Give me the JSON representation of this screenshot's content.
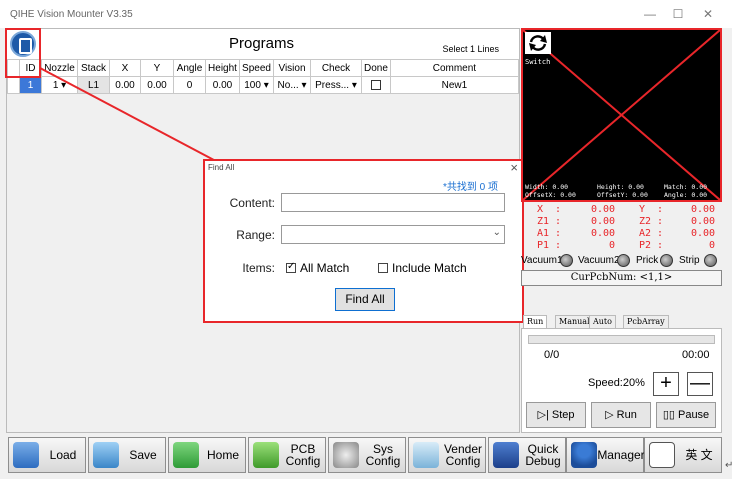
{
  "window": {
    "title": "QIHE Vision Mounter  V3.35",
    "controls": [
      "—",
      "☐",
      "✕"
    ]
  },
  "programs": {
    "title": "Programs",
    "select_info": "Select  1 Lines",
    "columns": [
      "ID",
      "Nozzle",
      "Stack",
      "X",
      "Y",
      "Angle",
      "Height",
      "Speed",
      "Vision",
      "Check",
      "Done",
      "Comment"
    ],
    "rows": [
      {
        "id": "1",
        "nozzle": "1",
        "stack": "L1",
        "x": "0.00",
        "y": "0.00",
        "angle": "0",
        "height": "0.00",
        "speed": "100",
        "vision": "No...",
        "check": "Press...",
        "done": false,
        "comment": "New1"
      }
    ]
  },
  "find_dialog": {
    "title": "Find All",
    "found_text": "*共找到 0 项",
    "content_label": "Content:",
    "content_value": "",
    "range_label": "Range:",
    "range_value": "",
    "items_label": "Items:",
    "all_match_label": "All Match",
    "all_match_checked": true,
    "include_match_label": "Include Match",
    "include_match_checked": false,
    "find_button": "Find All",
    "close": "×"
  },
  "camera": {
    "switch_label": "Switch",
    "width": "Width:   0.00",
    "offset_x": "OffsetX: 0.00",
    "height": "Height:  0.00",
    "offset_y": "OffsetY: 0.00",
    "match": "Match: 0.00",
    "angle": "Angle: 0.00"
  },
  "coords": {
    "x_label": "X  :",
    "x_val": "0.00",
    "y_label": "Y  :",
    "y_val": "0.00",
    "z1_label": "Z1 :",
    "z1_val": "0.00",
    "z2_label": "Z2 :",
    "z2_val": "0.00",
    "a1_label": "A1 :",
    "a1_val": "0.00",
    "a2_label": "A2 :",
    "a2_val": "0.00",
    "p1_label": "P1 :",
    "p1_val": "0",
    "p2_label": "P2 :",
    "p2_val": "0"
  },
  "indicators": {
    "vacuum1": "Vacuum1",
    "vacuum2": "Vacuum2",
    "prick": "Prick",
    "strip": "Strip"
  },
  "cur_pcb": "CurPcbNum: <1,1>",
  "run_tabs": [
    "Run",
    "Manual",
    "Auto",
    "PcbArray"
  ],
  "run_panel": {
    "count": "0/0",
    "time": "00:00",
    "speed": "Speed:20%",
    "plus": "+",
    "minus": "—",
    "step": "Step",
    "run": "Run",
    "pause": "Pause"
  },
  "toolbar": [
    {
      "label": "Load",
      "icon": "folder-icon"
    },
    {
      "label": "Save",
      "icon": "save-icon"
    },
    {
      "label": "Home",
      "icon": "home-icon"
    },
    {
      "label": "PCB Config",
      "icon": "pcb-icon"
    },
    {
      "label": "Sys Config",
      "icon": "gears-icon"
    },
    {
      "label": "Vender Config",
      "icon": "card-icon"
    },
    {
      "label": "Quick Debug",
      "icon": "debug-icon"
    },
    {
      "label": "Manager",
      "icon": "user-icon"
    },
    {
      "label": "英 文",
      "icon": "language-icon"
    }
  ],
  "colors": {
    "highlight": "#e8262a",
    "selected_row": "#3c78d8",
    "found_text": "#1a6fd1"
  }
}
